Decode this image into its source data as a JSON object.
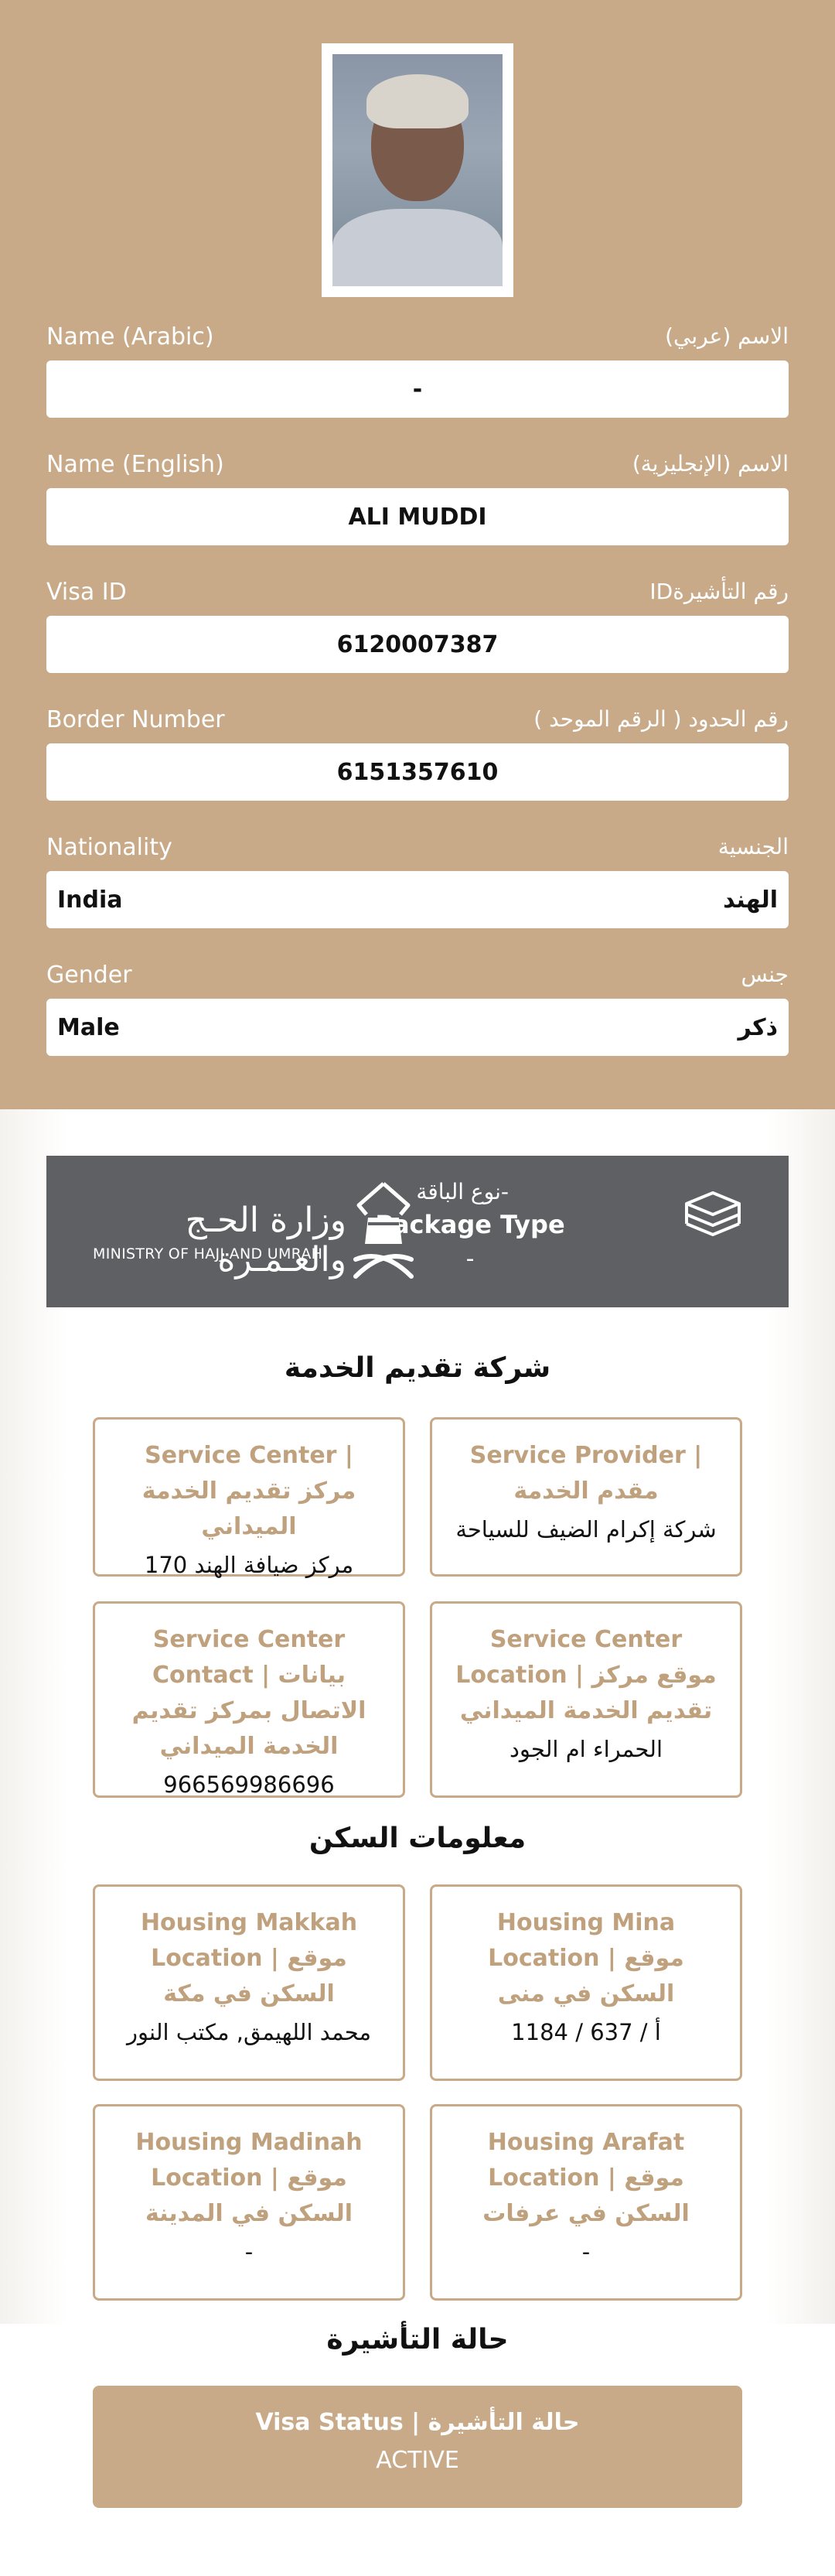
{
  "fields": [
    {
      "label_en": "Name (Arabic)",
      "label_ar": "الاسم (عربي)",
      "value": "-"
    },
    {
      "label_en": "Name (English)",
      "label_ar": "الاسم (الإنجليزية)",
      "value": "ALI MUDDI"
    },
    {
      "label_en": "Visa ID",
      "label_ar": "رقم التأشيرةID",
      "value": "6120007387"
    },
    {
      "label_en": "Border Number",
      "label_ar": "رقم الحدود ( الرقم الموحد )",
      "value": "6151357610"
    },
    {
      "label_en": "Nationality",
      "label_ar": "الجنسية",
      "value_en": "India",
      "value_ar": "الهند"
    },
    {
      "label_en": "Gender",
      "label_ar": "جنس",
      "value_en": "Male",
      "value_ar": "ذكر"
    }
  ],
  "banner": {
    "package_ar": "-نوع الباقة",
    "package_en": "Package Type",
    "package_value": "-",
    "ministry_ar": "وزارة الحـج والعـمـرة",
    "ministry_en": "MINISTRY OF HAJJ AND UMRAH",
    "icon_stack": "stacked-books-icon",
    "icon_emblem": "ministry-emblem-icon"
  },
  "service_section": {
    "title": "شركة تقديم الخدمة",
    "cards": [
      {
        "title": "Service Provider | مقدم الخدمة",
        "value": "شركة إكرام الضيف للسياحة"
      },
      {
        "title": "Service Center | مركز تقديم الخدمة الميداني",
        "value": "مركز ضيافة الهند 170"
      },
      {
        "title": "Service Center Location | موقع مركز تقديم الخدمة الميداني",
        "value": "الحمراء ام الجود"
      },
      {
        "title": "Service Center Contact | بيانات الاتصال بمركز تقديم الخدمة الميداني",
        "value": "966569986696"
      }
    ]
  },
  "housing_section": {
    "title": "معلومات السكن",
    "cards": [
      {
        "title": "Housing Mina Location | موقع السكن في منى",
        "value": "أ / 637 / 1184"
      },
      {
        "title": "Housing Makkah Location | موقع السكن في مكة",
        "value": "محمد اللهيمق, مكتب النور"
      },
      {
        "title": "Housing Arafat Location | موقع السكن في عرفات",
        "value": "-"
      },
      {
        "title": "Housing Madinah Location | موقع السكن في المدينة",
        "value": "-"
      }
    ]
  },
  "visa_section": {
    "title": "حالة التأشيرة",
    "status_label": "Visa Status | حالة التأشيرة",
    "status_value": "ACTIVE"
  },
  "colors": {
    "accent": "#c8aa88",
    "banner": "#5e6064",
    "card_title": "#c0a17e"
  }
}
